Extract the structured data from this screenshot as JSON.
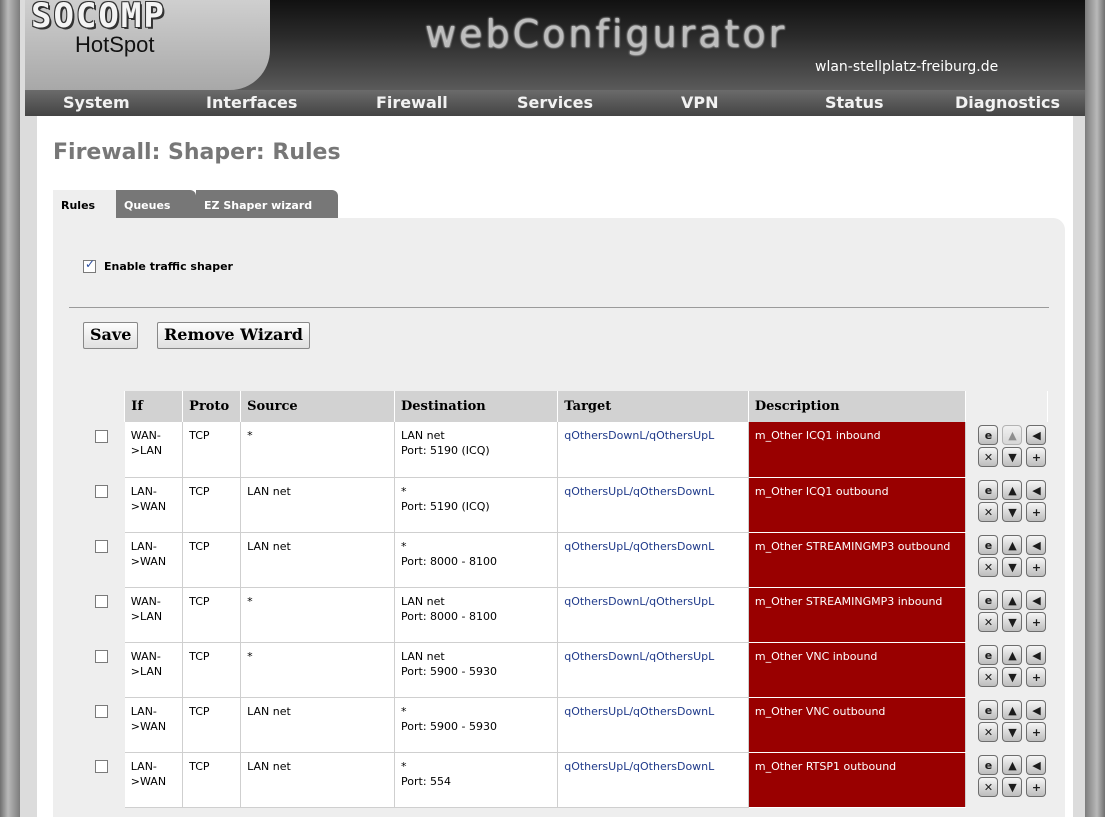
{
  "header": {
    "logo_main": "SOCOMP",
    "logo_sub": "HotSpot",
    "app_title": "webConfigurator",
    "domain": "wlan-stellplatz-freiburg.de"
  },
  "nav": {
    "system": "System",
    "interfaces": "Interfaces",
    "firewall": "Firewall",
    "services": "Services",
    "vpn": "VPN",
    "status": "Status",
    "diagnostics": "Diagnostics"
  },
  "page": {
    "title": "Firewall: Shaper: Rules"
  },
  "tabs": {
    "rules": "Rules",
    "queues": "Queues",
    "wizard": "EZ Shaper wizard"
  },
  "shaper": {
    "enable_label": "Enable traffic shaper",
    "enabled": true
  },
  "buttons": {
    "save": "Save",
    "remove_wizard": "Remove Wizard"
  },
  "table": {
    "headers": {
      "if": "If",
      "proto": "Proto",
      "source": "Source",
      "destination": "Destination",
      "target": "Target",
      "description": "Description"
    },
    "rows": [
      {
        "if1": "WAN-",
        "if2": ">LAN",
        "proto": "TCP",
        "source": "*",
        "dest1": "LAN net",
        "dest2": "Port: 5190 (ICQ)",
        "target": "qOthersDownL/qOthersUpL",
        "desc": "m_Other ICQ1 inbound"
      },
      {
        "if1": "LAN-",
        "if2": ">WAN",
        "proto": "TCP",
        "source": "LAN net",
        "dest1": "*",
        "dest2": "Port: 5190 (ICQ)",
        "target": "qOthersUpL/qOthersDownL",
        "desc": "m_Other ICQ1 outbound"
      },
      {
        "if1": "LAN-",
        "if2": ">WAN",
        "proto": "TCP",
        "source": "LAN net",
        "dest1": "*",
        "dest2": "Port: 8000 - 8100",
        "target": "qOthersUpL/qOthersDownL",
        "desc": "m_Other STREAMINGMP3 outbound"
      },
      {
        "if1": "WAN-",
        "if2": ">LAN",
        "proto": "TCP",
        "source": "*",
        "dest1": "LAN net",
        "dest2": "Port: 8000 - 8100",
        "target": "qOthersDownL/qOthersUpL",
        "desc": "m_Other STREAMINGMP3 inbound"
      },
      {
        "if1": "WAN-",
        "if2": ">LAN",
        "proto": "TCP",
        "source": "*",
        "dest1": "LAN net",
        "dest2": "Port: 5900 - 5930",
        "target": "qOthersDownL/qOthersUpL",
        "desc": "m_Other VNC inbound"
      },
      {
        "if1": "LAN-",
        "if2": ">WAN",
        "proto": "TCP",
        "source": "LAN net",
        "dest1": "*",
        "dest2": "Port: 5900 - 5930",
        "target": "qOthersUpL/qOthersDownL",
        "desc": "m_Other VNC outbound"
      },
      {
        "if1": "LAN-",
        "if2": ">WAN",
        "proto": "TCP",
        "source": "LAN net",
        "dest1": "*",
        "dest2": "Port: 554",
        "target": "qOthersUpL/qOthersDownL",
        "desc": "m_Other RTSP1 outbound"
      }
    ]
  },
  "icons": {
    "edit": "edit-icon",
    "move_up": "move-up-icon",
    "move_before": "move-before-icon",
    "delete": "delete-icon",
    "move_down": "move-down-icon",
    "add": "add-icon"
  }
}
